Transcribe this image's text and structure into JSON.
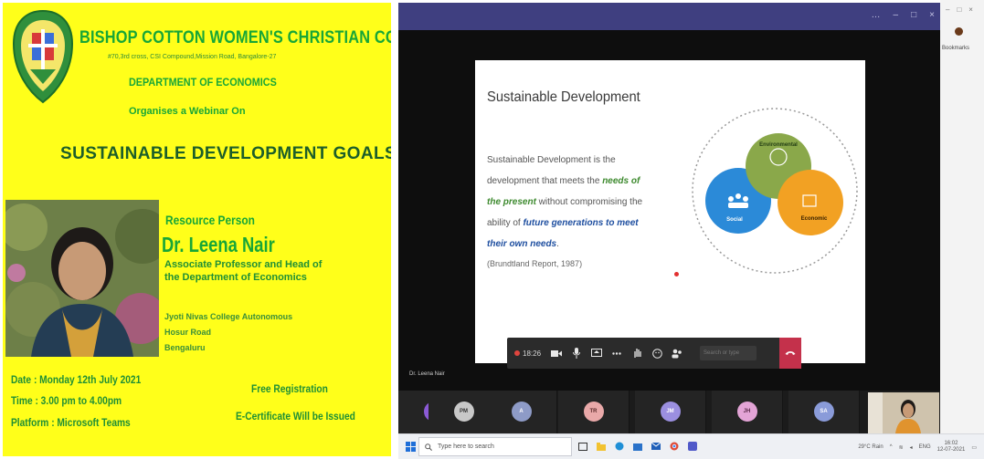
{
  "poster": {
    "college_name": "BISHOP COTTON WOMEN'S CHRISTIAN COLLEGE",
    "address": "#70,3rd cross, CSI Compound,Mission Road, Bangalore-27",
    "department": "DEPARTMENT OF  ECONOMICS",
    "organises": "Organises a Webinar On",
    "webinar_title": "SUSTAINABLE  DEVELOPMENT GOALS",
    "resource_person_label": "Resource Person",
    "speaker_name": "Dr. Leena Nair",
    "designation": "Associate Professor and Head of the Department of Economics",
    "institution_lines": [
      "Jyoti Nivas College Autonomous",
      "Hosur Road",
      "Bengaluru"
    ],
    "date": "Date : Monday  12th July 2021",
    "time": "Time : 3.00 pm to 4.00pm",
    "platform": "Platform : Microsoft Teams",
    "registration": "Free Registration",
    "certificate": "E-Certificate Will be  Issued",
    "colors": {
      "background": "#ffff1a",
      "accent": "#18a637"
    }
  },
  "teams": {
    "window_controls": [
      "…",
      "–",
      "□",
      "×"
    ],
    "slide": {
      "title": "Sustainable Development",
      "body_pre": "Sustainable Development is the development that meets the ",
      "body_emph_1": "needs of the present",
      "body_mid": " without compromising the ability of ",
      "body_emph_2": "future generations to meet their own needs",
      "body_end": ".",
      "citation": "(Brundtland Report, 1987)",
      "venn_labels": {
        "top": "Environmental",
        "left": "Social",
        "right": "Economic"
      }
    },
    "presenter_label": "Dr. Leena Nair",
    "controls": {
      "timer": "18:26",
      "icons": [
        "video-icon",
        "mic-icon",
        "share-icon",
        "chat-icon",
        "more-icon",
        "raise-hand-icon",
        "reactions-icon",
        "participants-icon"
      ],
      "search_placeholder": "Search or type"
    },
    "participants": [
      {
        "initials": "HS",
        "color": "#8b5ad6"
      },
      {
        "initials": "PM",
        "color": "#c8c8c8"
      },
      {
        "initials": "A",
        "color": "#8e9bc7"
      },
      {
        "initials": "TR",
        "color": "#e9a9a9"
      },
      {
        "initials": "JM",
        "color": "#9b8fe0"
      },
      {
        "initials": "JH",
        "color": "#e3a4d6"
      },
      {
        "initials": "SA",
        "color": "#8a9bd9"
      }
    ]
  },
  "browser_strip": {
    "controls": [
      "–",
      "□",
      "×"
    ],
    "label": "Bookmarks"
  },
  "taskbar": {
    "search_placeholder": "Type here to search",
    "tray_weather": "29°C  Rain",
    "tray_lang": "ENG",
    "tray_time": "16:02",
    "tray_date": "12-07-2021"
  }
}
